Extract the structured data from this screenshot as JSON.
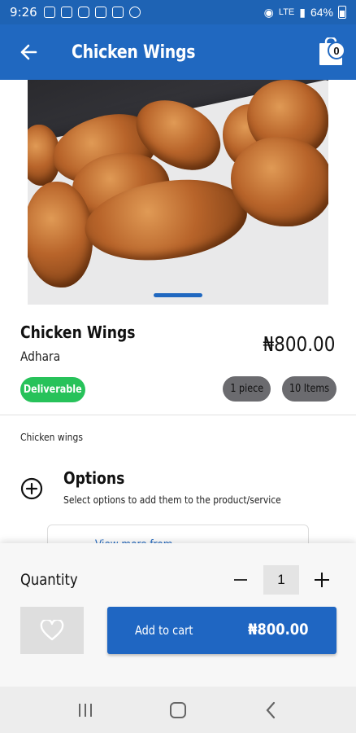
{
  "status_bar": {
    "time": "9:26",
    "signal": "LTE",
    "battery": "64%"
  },
  "app_bar": {
    "title": "Chicken Wings",
    "cart_count": "0"
  },
  "product": {
    "name": "Chicken Wings",
    "seller": "Adhara",
    "price": "₦800.00",
    "badge": "Deliverable",
    "unit_chip": "1 piece",
    "stock_chip": "10 Items",
    "description": "Chicken wings"
  },
  "options": {
    "title": "Options",
    "subtitle": "Select options to add them to the product/service",
    "view_more": "View more from"
  },
  "purchase": {
    "quantity_label": "Quantity",
    "quantity_value": "1",
    "add_to_cart_label": "Add to cart",
    "add_to_cart_price": "₦800.00"
  },
  "colors": {
    "primary": "#2068c0",
    "deliverable": "#27c25a",
    "chip_grey": "#6b6b6f"
  },
  "icons": {
    "back": "arrow-left-icon",
    "cart": "shopping-bag-icon",
    "options": "plus-circle-icon",
    "favorite": "heart-icon",
    "nav_recents": "recents-icon",
    "nav_home": "home-icon",
    "nav_back": "chevron-left-icon"
  }
}
